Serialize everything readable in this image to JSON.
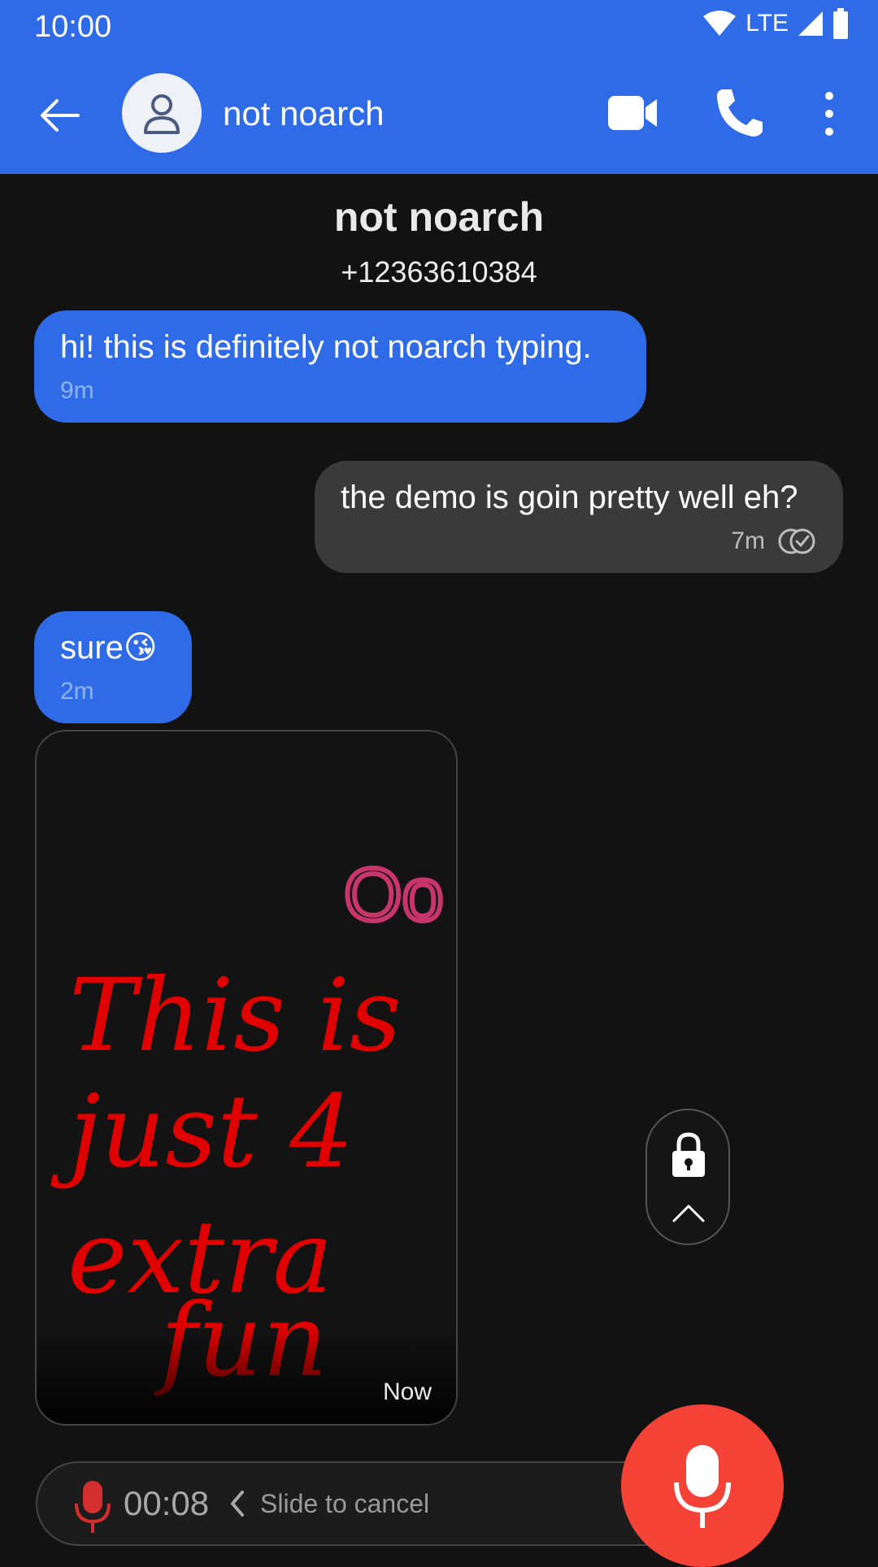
{
  "status_bar": {
    "time": "10:00",
    "network": "LTE"
  },
  "app_bar": {
    "title": "not noarch"
  },
  "contact": {
    "name": "not noarch",
    "phone": "+12363610384"
  },
  "messages": [
    {
      "direction": "in",
      "text": "hi! this is definitely not noarch typing.",
      "time": "9m"
    },
    {
      "direction": "out",
      "text": "the demo is goin pretty well eh?",
      "time": "7m"
    },
    {
      "direction": "in",
      "text": "sure😘",
      "time": "2m"
    }
  ],
  "image_message": {
    "handwriting": [
      "Oo",
      "This is",
      "just 4",
      "extra",
      "fun"
    ],
    "time": "Now"
  },
  "recording": {
    "timer": "00:08",
    "slide_hint": "Slide to cancel"
  },
  "colors": {
    "accent": "#2f6be6",
    "outgoing_bubble": "#3a3a3a",
    "record": "#f44336",
    "ink": "#e00000",
    "ink_pink": "#c8356b"
  }
}
